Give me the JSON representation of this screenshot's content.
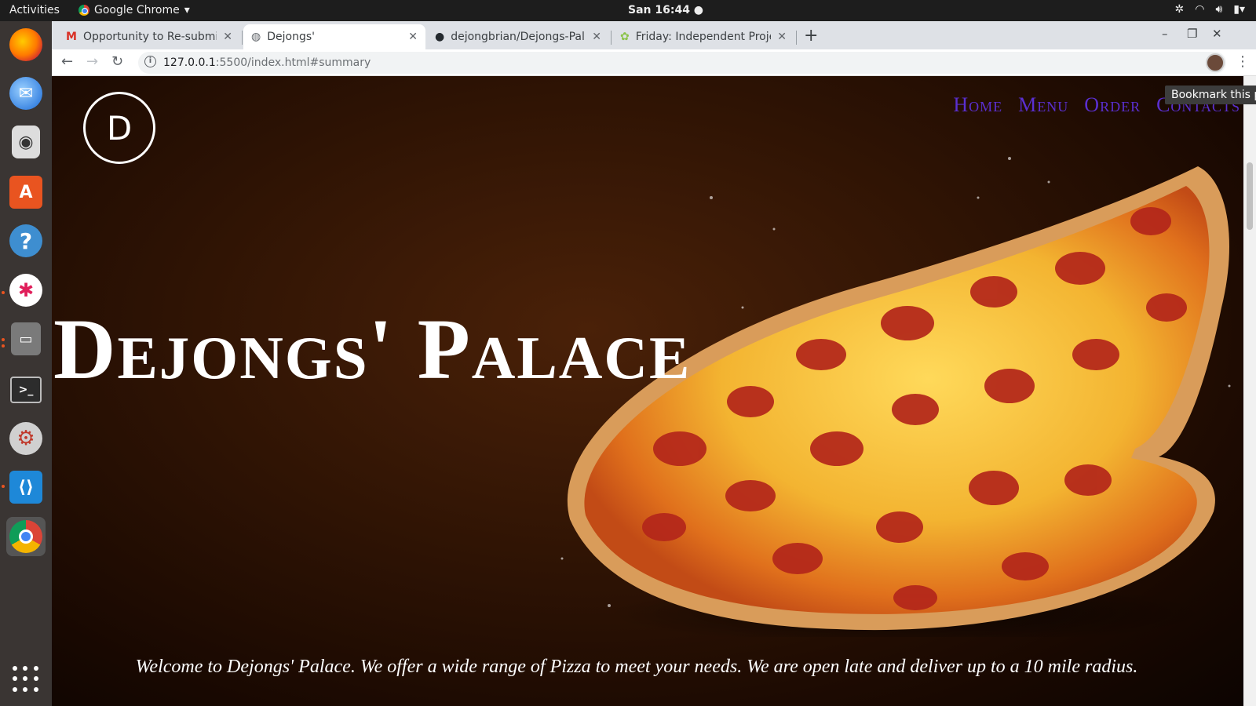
{
  "system": {
    "activities": "Activities",
    "app_name": "Google Chrome",
    "clock": "San 16:44"
  },
  "dock": {
    "items": [
      "firefox-icon",
      "thunderbird-icon",
      "rhythmbox-icon",
      "software-center-icon",
      "help-icon",
      "slack-icon",
      "files-icon",
      "terminal-icon",
      "settings-icon",
      "vscode-icon",
      "chrome-icon"
    ]
  },
  "browser": {
    "tabs": [
      {
        "title": "Opportunity to Re-submit"
      },
      {
        "title": "Dejongs'"
      },
      {
        "title": "dejongbrian/Dejongs-Pal"
      },
      {
        "title": "Friday: Independent Proje"
      }
    ],
    "url_host": "127.0.0.1",
    "url_rest": ":5500/index.html#summary",
    "tooltip": "Bookmark this page"
  },
  "site": {
    "logo_letter": "D",
    "nav": [
      "Home",
      "Menu",
      "Order",
      "Contacts"
    ],
    "title": "Dejongs' Palace",
    "welcome": "Welcome to Dejongs' Palace. We offer a wide range of Pizza to meet your needs. We are open late and deliver up to a 10 mile radius."
  },
  "colors": {
    "nav_link": "#5a2fd0",
    "ubuntu_orange": "#e95420"
  }
}
